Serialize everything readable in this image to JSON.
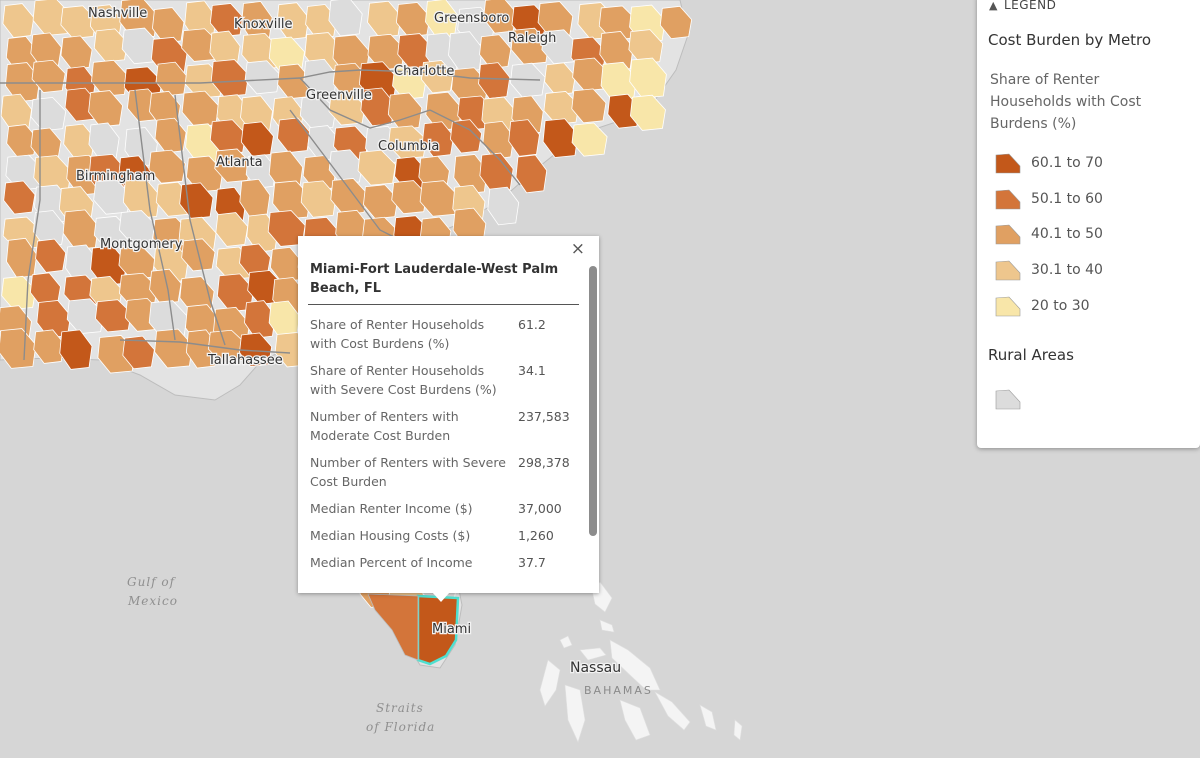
{
  "colors": {
    "c60_70": "#c3581a",
    "c50_60": "#d3753a",
    "c40_50": "#e0a062",
    "c30_40": "#eec68d",
    "c20_30": "#f8e6a9",
    "rural": "#dcdcdc",
    "land": "#e3e3e3",
    "water": "#d6d6d6"
  },
  "map": {
    "cities": [
      "Nashville",
      "Knoxville",
      "Greensboro",
      "Raleigh",
      "Charlotte",
      "Greenville",
      "Columbia",
      "Atlanta",
      "Birmingham",
      "Montgomery",
      "Tallahassee",
      "Miami",
      "Nassau"
    ],
    "water_labels": [
      "Gulf of",
      "Mexico",
      "Straits",
      "of Florida"
    ],
    "country_label": "BAHAMAS"
  },
  "popup": {
    "close": "×",
    "title": "Miami-Fort Lauderdale-West Palm Beach, FL",
    "rows": [
      {
        "label": "Share of Renter Households with Cost Burdens (%)",
        "value": "61.2"
      },
      {
        "label": "Share of Renter Households with Severe Cost Burdens (%)",
        "value": "34.1"
      },
      {
        "label": "Number of Renters with Moderate Cost Burden",
        "value": "237,583"
      },
      {
        "label": "Number of Renters with Severe Cost Burden",
        "value": "298,378"
      },
      {
        "label": "Median Renter Income ($)",
        "value": "37,000"
      },
      {
        "label": "Median Housing Costs ($)",
        "value": "1,260"
      },
      {
        "label": "Median Percent of Income",
        "value": "37.7"
      }
    ]
  },
  "legend": {
    "header": "LEGEND",
    "title": "Cost Burden by Metro",
    "subtitle": "Share of Renter Households with Cost Burdens (%)",
    "items": [
      {
        "label": "60.1 to 70",
        "color_key": "c60_70"
      },
      {
        "label": "50.1 to 60",
        "color_key": "c50_60"
      },
      {
        "label": "40.1 to 50",
        "color_key": "c40_50"
      },
      {
        "label": "30.1 to 40",
        "color_key": "c30_40"
      },
      {
        "label": "20 to 30",
        "color_key": "c20_30"
      }
    ],
    "rural_title": "Rural Areas"
  }
}
